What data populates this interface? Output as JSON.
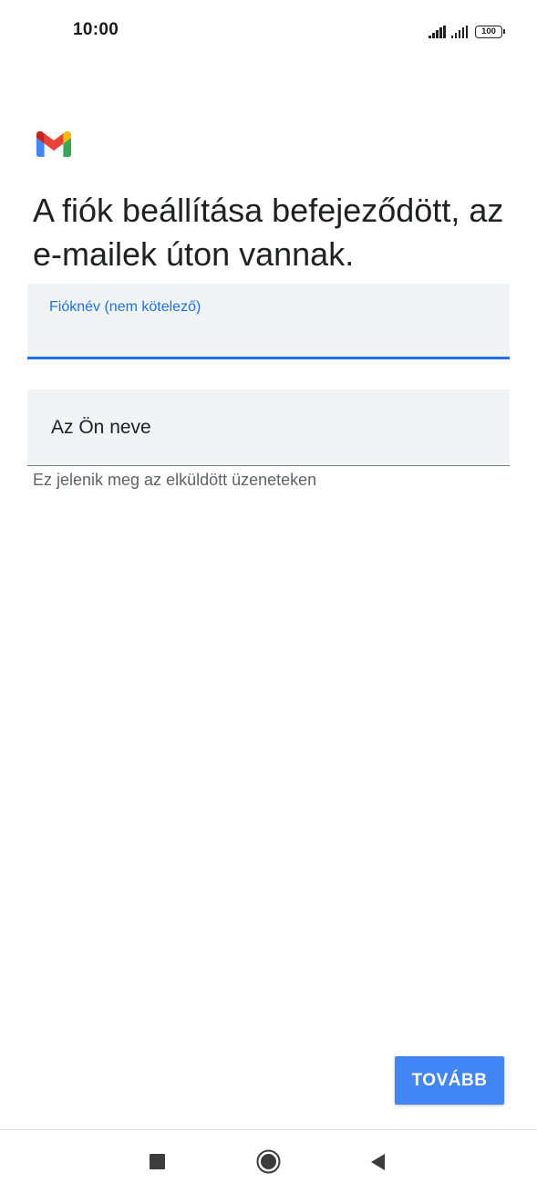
{
  "status_bar": {
    "time": "10:00",
    "battery": "100",
    "icons": [
      "signal-icon",
      "signal-icon",
      "battery-icon"
    ]
  },
  "app": {
    "logo": "gmail-logo",
    "colors": {
      "accent": "#1a73e8",
      "button": "#4285f4",
      "field_bg": "#f1f3f4"
    }
  },
  "main": {
    "title": "A fiók beállítása befejeződött, az e-mailek úton vannak.",
    "account_name_field": {
      "label": "Fióknév (nem kötelező)",
      "value": ""
    },
    "your_name_field": {
      "placeholder": "Az Ön neve",
      "value": ""
    },
    "helper_text": "Ez jelenik meg az elküldött üzeneteken"
  },
  "actions": {
    "next_label": "TOVÁBB"
  },
  "nav_bar": {
    "icons": [
      "recents-icon",
      "home-icon",
      "back-icon"
    ]
  }
}
